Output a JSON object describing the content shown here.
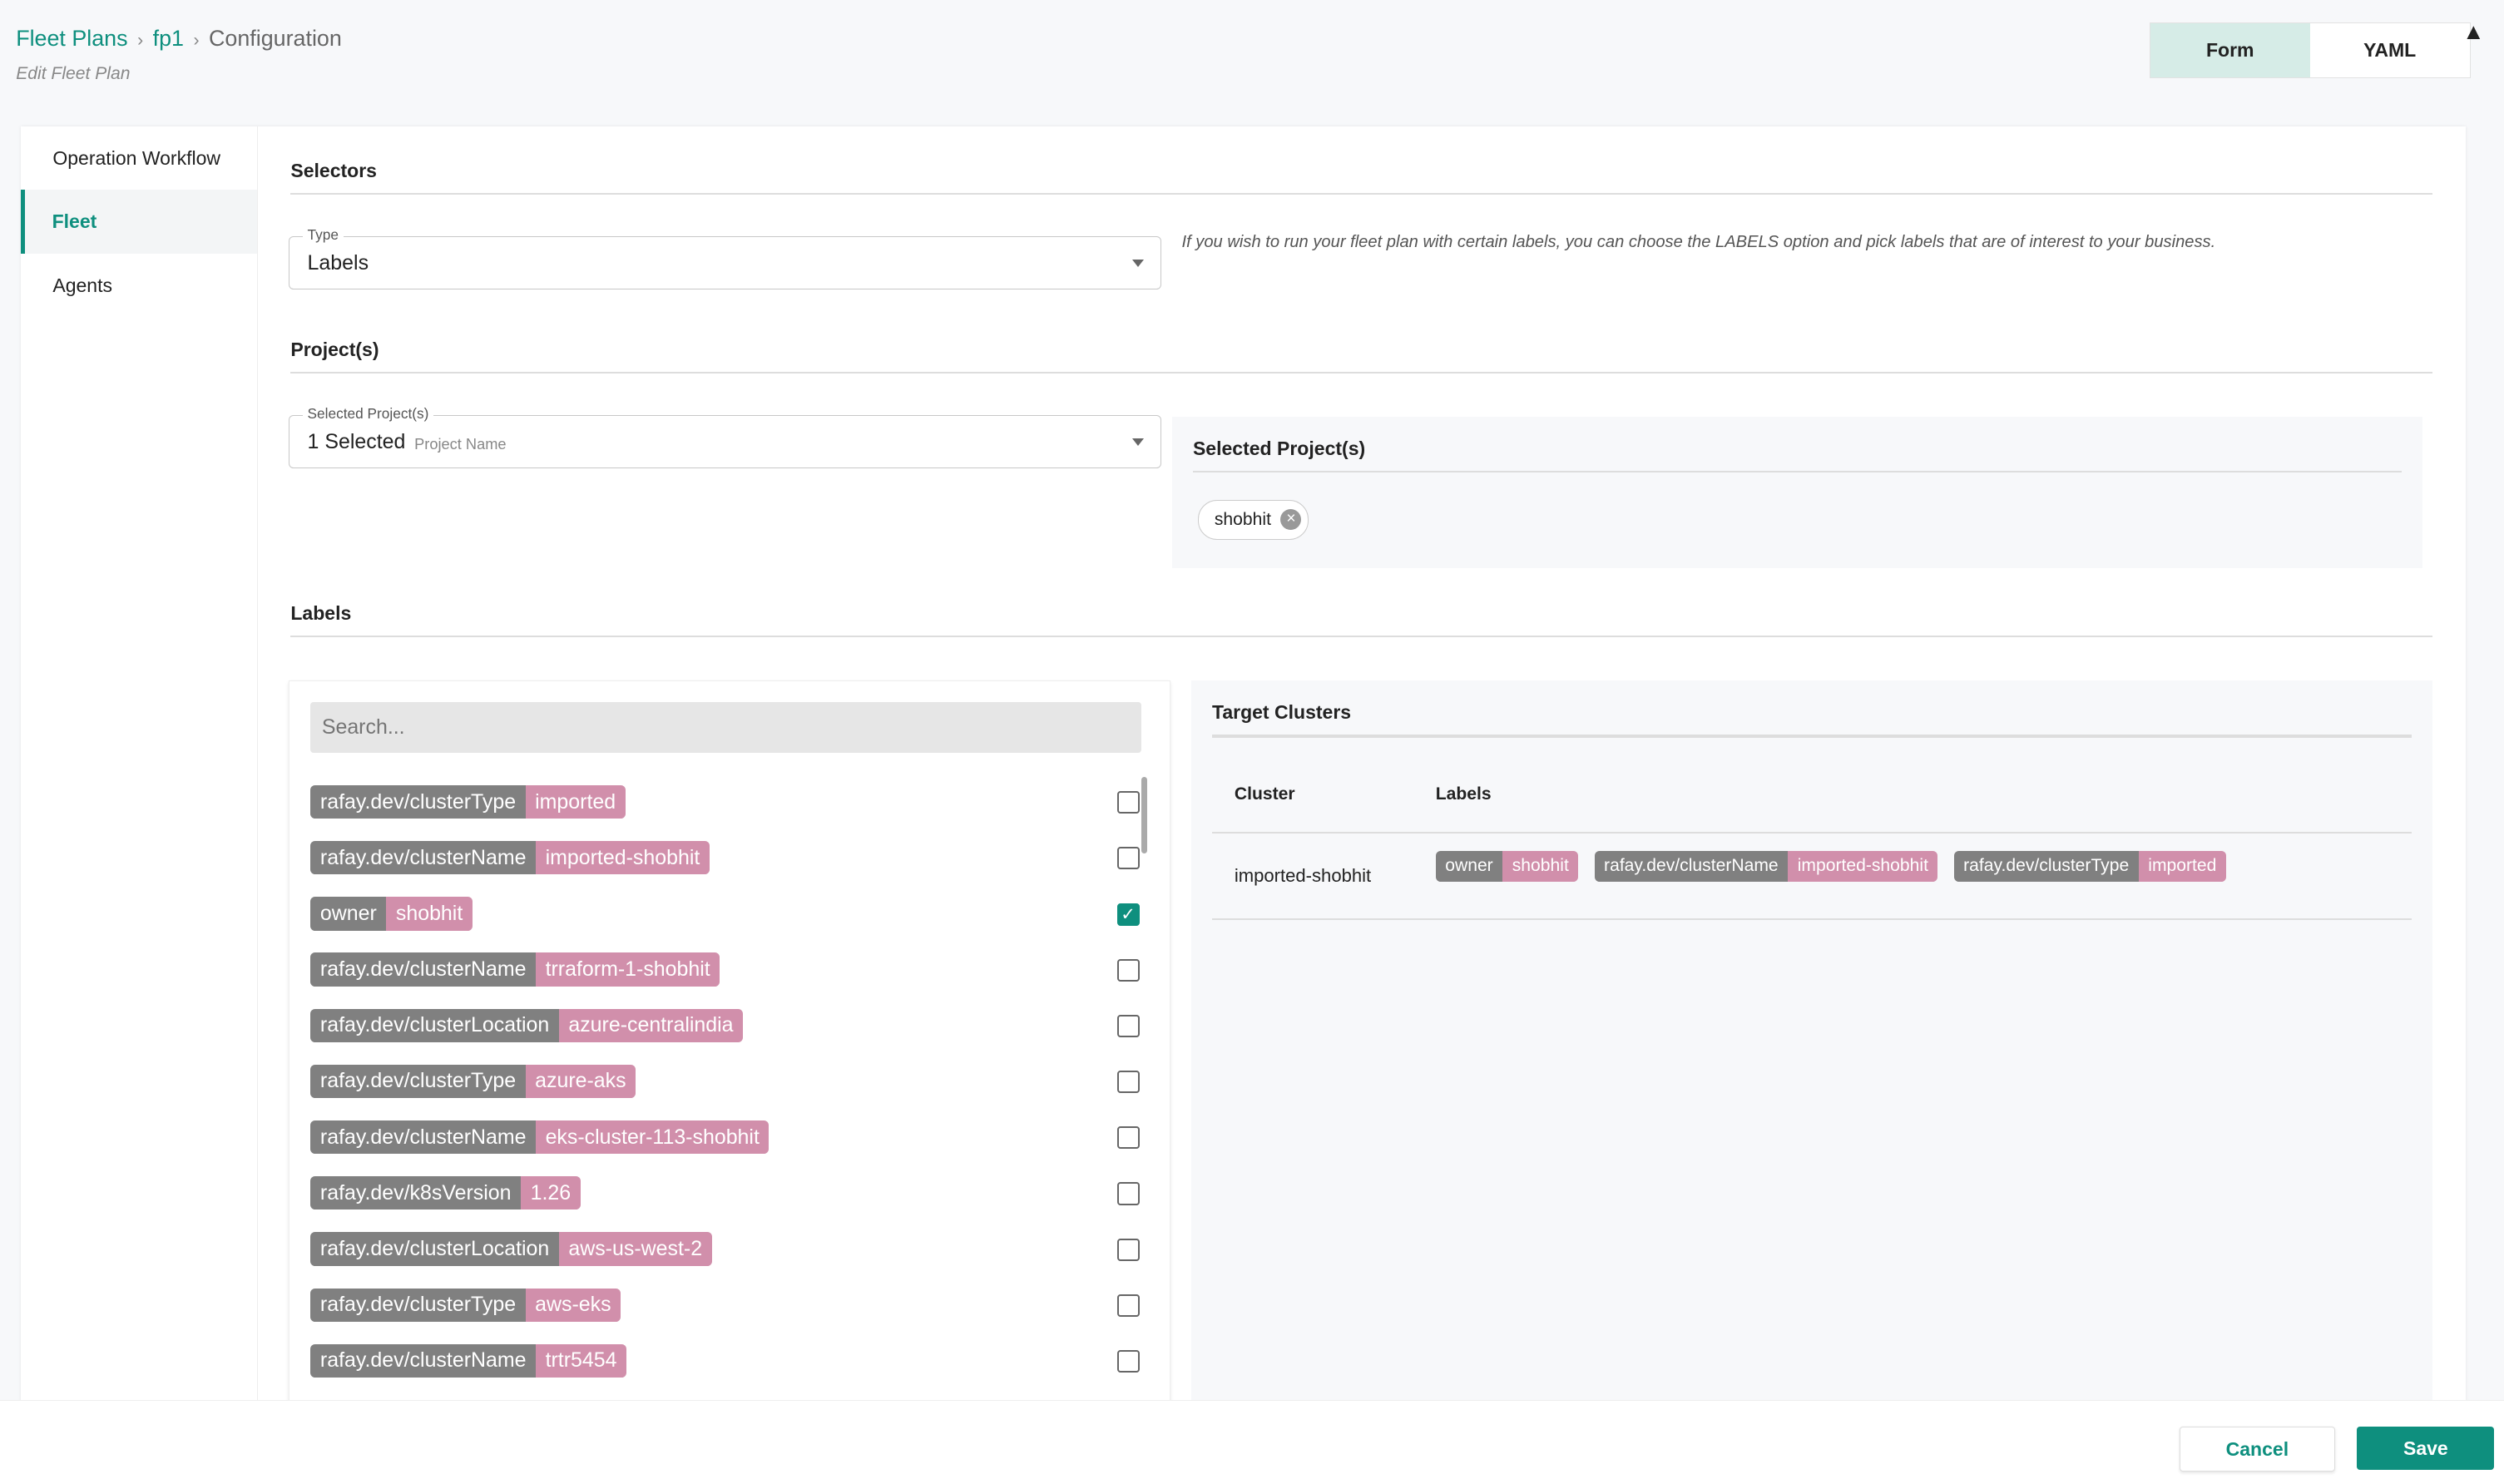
{
  "breadcrumb": {
    "items": [
      "Fleet Plans",
      "fp1"
    ],
    "current": "Configuration"
  },
  "subtitle": "Edit Fleet Plan",
  "view_toggle": {
    "form": "Form",
    "yaml": "YAML",
    "active": "Form"
  },
  "sidebar": {
    "items": [
      {
        "label": "Operation Workflow"
      },
      {
        "label": "Fleet",
        "active": true
      },
      {
        "label": "Agents"
      }
    ]
  },
  "selectors": {
    "title": "Selectors",
    "type_label": "Type",
    "type_value": "Labels",
    "hint": "If you wish to run your fleet plan with certain labels, you can choose the LABELS option and pick labels that are of interest to your business."
  },
  "projects": {
    "title": "Project(s)",
    "field_label": "Selected Project(s)",
    "value": "1 Selected",
    "placeholder": "Project Name",
    "panel_title": "Selected Project(s)",
    "chips": [
      "shobhit"
    ]
  },
  "labels": {
    "title": "Labels",
    "search_placeholder": "Search...",
    "items": [
      {
        "key": "rafay.dev/clusterType",
        "value": "imported",
        "checked": false
      },
      {
        "key": "rafay.dev/clusterName",
        "value": "imported-shobhit",
        "checked": false
      },
      {
        "key": "owner",
        "value": "shobhit",
        "checked": true
      },
      {
        "key": "rafay.dev/clusterName",
        "value": "trraform-1-shobhit",
        "checked": false
      },
      {
        "key": "rafay.dev/clusterLocation",
        "value": "azure-centralindia",
        "checked": false
      },
      {
        "key": "rafay.dev/clusterType",
        "value": "azure-aks",
        "checked": false
      },
      {
        "key": "rafay.dev/clusterName",
        "value": "eks-cluster-113-shobhit",
        "checked": false
      },
      {
        "key": "rafay.dev/k8sVersion",
        "value": "1.26",
        "checked": false
      },
      {
        "key": "rafay.dev/clusterLocation",
        "value": "aws-us-west-2",
        "checked": false
      },
      {
        "key": "rafay.dev/clusterType",
        "value": "aws-eks",
        "checked": false
      },
      {
        "key": "rafay.dev/clusterName",
        "value": "trtr5454",
        "checked": false
      }
    ]
  },
  "target": {
    "title": "Target Clusters",
    "columns": [
      "Cluster",
      "Labels"
    ],
    "rows": [
      {
        "cluster": "imported-shobhit",
        "labels": [
          {
            "key": "owner",
            "value": "shobhit"
          },
          {
            "key": "rafay.dev/clusterName",
            "value": "imported-shobhit"
          },
          {
            "key": "rafay.dev/clusterType",
            "value": "imported"
          }
        ]
      }
    ]
  },
  "footer": {
    "cancel": "Cancel",
    "save": "Save"
  },
  "colors": {
    "accent": "#0e8f7e",
    "tag_key": "#808080",
    "tag_value": "#d18fab"
  }
}
